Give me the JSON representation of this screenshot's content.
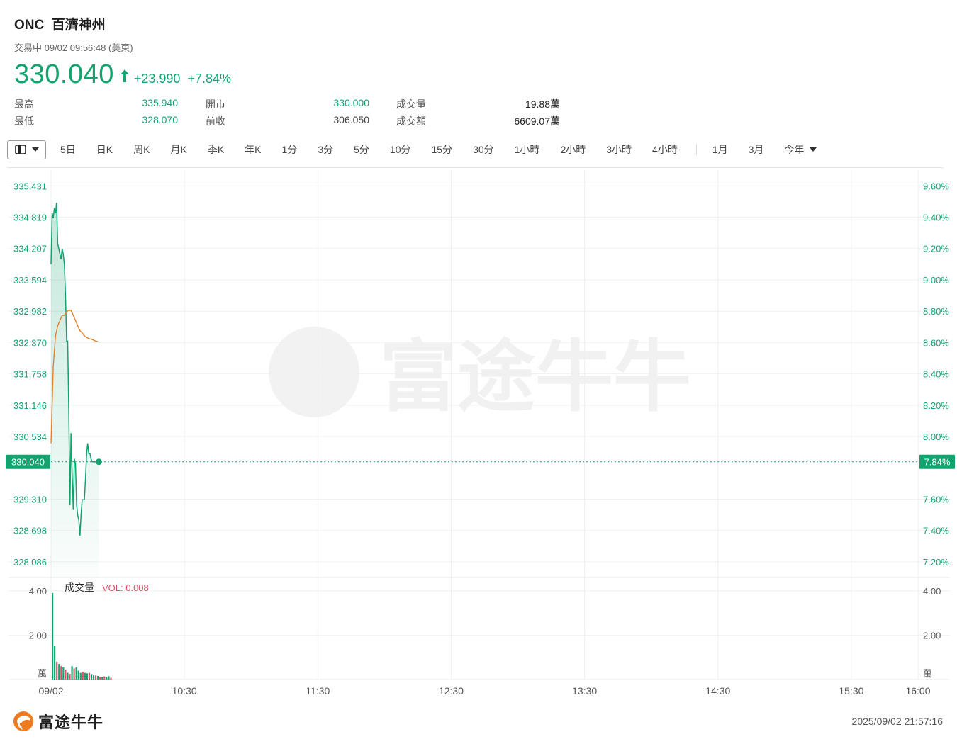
{
  "header": {
    "ticker": "ONC",
    "name": "百濟神州",
    "status": "交易中 09/02 09:56:48 (美東)",
    "price": "330.040",
    "change": "+23.990",
    "change_pct": "+7.84%"
  },
  "stats": {
    "high_label": "最高",
    "high": "335.940",
    "low_label": "最低",
    "low": "328.070",
    "open_label": "開市",
    "open": "330.000",
    "prev_label": "前收",
    "prev": "306.050",
    "volume_label": "成交量",
    "volume": "19.88萬",
    "turnover_label": "成交額",
    "turnover": "6609.07萬"
  },
  "tabs": [
    "5日",
    "日K",
    "周K",
    "月K",
    "季K",
    "年K",
    "1分",
    "3分",
    "5分",
    "10分",
    "15分",
    "30分",
    "1小時",
    "2小時",
    "3小時",
    "4小時",
    "1月",
    "3月",
    "今年"
  ],
  "colors": {
    "up": "#12a36f",
    "avg": "#e6802a",
    "vol_down": "#e0506a"
  },
  "chart_data": {
    "type": "line",
    "price_axis_ticks": [
      "335.431",
      "334.819",
      "334.207",
      "333.594",
      "332.982",
      "332.370",
      "331.758",
      "331.146",
      "330.534",
      "330.040",
      "329.310",
      "328.698",
      "328.086"
    ],
    "pct_axis_ticks": [
      "9.60%",
      "9.40%",
      "9.20%",
      "9.00%",
      "8.80%",
      "8.60%",
      "8.40%",
      "8.20%",
      "8.00%",
      "7.84%",
      "7.60%",
      "7.40%",
      "7.20%"
    ],
    "current_price_label": "330.040",
    "current_pct_label": "7.84%",
    "ylim": [
      327.78,
      335.74
    ],
    "x_ticks": [
      "09/02",
      "10:30",
      "11:30",
      "12:30",
      "13:30",
      "14:30",
      "15:30",
      "16:00"
    ],
    "x_range_minutes": [
      0,
      390
    ],
    "price_series": {
      "x": [
        0,
        0.5,
        1,
        1.5,
        2,
        2.5,
        3,
        3.5,
        4,
        4.5,
        5,
        5.5,
        6,
        6.5,
        7,
        7.5,
        8,
        8.5,
        9,
        9.5,
        10,
        10.5,
        11,
        11.5,
        12,
        12.5,
        13,
        13.5,
        14,
        14.5,
        15,
        15.5,
        16,
        16.5,
        17,
        17.5,
        18,
        18.5,
        19,
        19.5,
        20,
        20.5,
        21,
        21.5,
        22,
        22.5,
        23,
        23.5,
        24,
        24.5,
        25,
        25.5,
        26,
        26.5,
        27
      ],
      "values": [
        333.9,
        334.9,
        334.8,
        335.0,
        334.9,
        335.1,
        334.3,
        334.2,
        334.1,
        334.0,
        334.2,
        334.1,
        333.9,
        333.3,
        332.4,
        332.4,
        331.0,
        329.2,
        330.6,
        329.8,
        329.1,
        330.1,
        330.0,
        329.2,
        329.0,
        328.9,
        328.6,
        329.0,
        329.3,
        329.3,
        329.3,
        329.7,
        330.2,
        330.4,
        330.2,
        330.2,
        330.1,
        330.04,
        330.04,
        330.04,
        330.04,
        330.04,
        330.04,
        330.04,
        330.04,
        330.04,
        330.04,
        330.04,
        330.04,
        330.04,
        330.04,
        330.04,
        330.04,
        330.04,
        330.04
      ]
    },
    "avg_series": {
      "x": [
        0,
        1,
        2,
        3,
        4,
        5,
        6,
        7,
        8,
        9,
        10,
        11,
        12,
        13,
        14,
        15,
        16,
        17,
        18,
        19,
        20,
        21,
        22,
        23,
        24,
        25,
        26,
        27
      ],
      "values": [
        330.4,
        331.9,
        332.5,
        332.7,
        332.8,
        332.9,
        332.9,
        332.98,
        333.0,
        333.0,
        332.9,
        332.8,
        332.7,
        332.6,
        332.56,
        332.5,
        332.47,
        332.45,
        332.44,
        332.42,
        332.4,
        332.39,
        332.38,
        332.37,
        332.37,
        332.37,
        332.37,
        332.37
      ]
    },
    "volume": {
      "label": "成交量",
      "indicator": "VOL: 0.008",
      "unit": "萬",
      "axis_ticks": [
        "4.00",
        "2.00"
      ],
      "ylim": [
        0,
        4.6
      ],
      "x": [
        0,
        1,
        2,
        3,
        4,
        5,
        6,
        7,
        8,
        9,
        10,
        11,
        12,
        13,
        14,
        15,
        16,
        17,
        18,
        19,
        20,
        21,
        22,
        23,
        24,
        25,
        26,
        27
      ],
      "values": [
        3.9,
        1.5,
        0.8,
        0.7,
        0.6,
        0.55,
        0.45,
        0.3,
        0.25,
        0.6,
        0.5,
        0.55,
        0.4,
        0.3,
        0.35,
        0.3,
        0.28,
        0.3,
        0.25,
        0.2,
        0.18,
        0.16,
        0.12,
        0.1,
        0.14,
        0.12,
        0.15,
        0.08
      ],
      "up": [
        1,
        1,
        0,
        1,
        0,
        1,
        0,
        1,
        0,
        1,
        0,
        1,
        1,
        1,
        0,
        1,
        1,
        0,
        1,
        1,
        0,
        1,
        0,
        1,
        0,
        1,
        1,
        0
      ]
    }
  },
  "footer": {
    "brand": "富途牛牛",
    "timestamp": "2025/09/02 21:57:16"
  }
}
